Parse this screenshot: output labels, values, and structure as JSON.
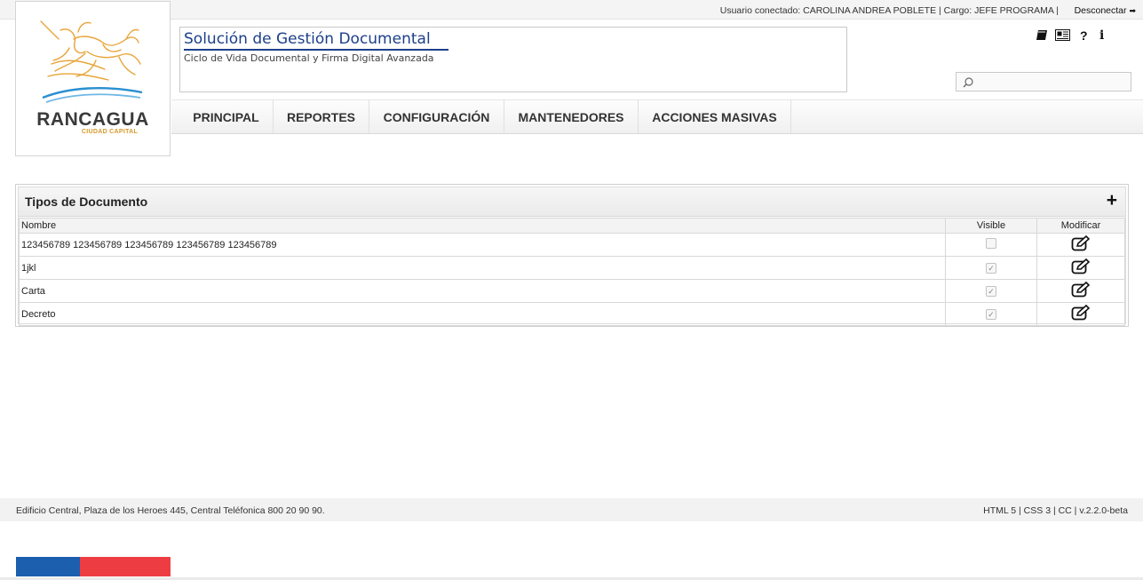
{
  "topbar": {
    "user_info": "Usuario conectado: CAROLINA ANDREA POBLETE | Cargo: JEFE PROGRAMA |",
    "logout_label": "Desconectar"
  },
  "logo": {
    "name": "RANCAGUA",
    "tagline": "CIUDAD CAPITAL"
  },
  "header": {
    "title": "Solución de Gestión Documental",
    "subtitle": "Ciclo de Vida Documental y Firma Digital Avanzada",
    "icons": [
      "book-icon",
      "newspaper-icon",
      "help-icon",
      "info-icon"
    ],
    "icon_glyphs": [
      "▰",
      "▤",
      "?",
      "i"
    ]
  },
  "search": {
    "placeholder": "",
    "value": ""
  },
  "nav": {
    "items": [
      {
        "label": "PRINCIPAL"
      },
      {
        "label": "REPORTES"
      },
      {
        "label": "CONFIGURACIÓN"
      },
      {
        "label": "MANTENEDORES"
      },
      {
        "label": "ACCIONES MASIVAS"
      }
    ]
  },
  "panel": {
    "title": "Tipos de Documento",
    "add_glyph": "+",
    "columns": {
      "name": "Nombre",
      "visible": "Visible",
      "modify": "Modificar"
    },
    "rows": [
      {
        "name": "123456789 123456789 123456789 123456789 123456789",
        "visible": false
      },
      {
        "name": "1jkl",
        "visible": true
      },
      {
        "name": "Carta",
        "visible": true
      },
      {
        "name": "Decreto",
        "visible": true
      }
    ]
  },
  "footer": {
    "address": "Edificio Central, Plaza de los Heroes 445, Central Teléfonica 800 20 90 90.",
    "tech": "HTML 5 | CSS 3 | CC | v.2.2.0-beta"
  },
  "colors": {
    "title_blue": "#1c3f8a",
    "flag_blue": "#1c5fae",
    "flag_red": "#ee3d42",
    "logo_gold": "#e8a53a"
  }
}
